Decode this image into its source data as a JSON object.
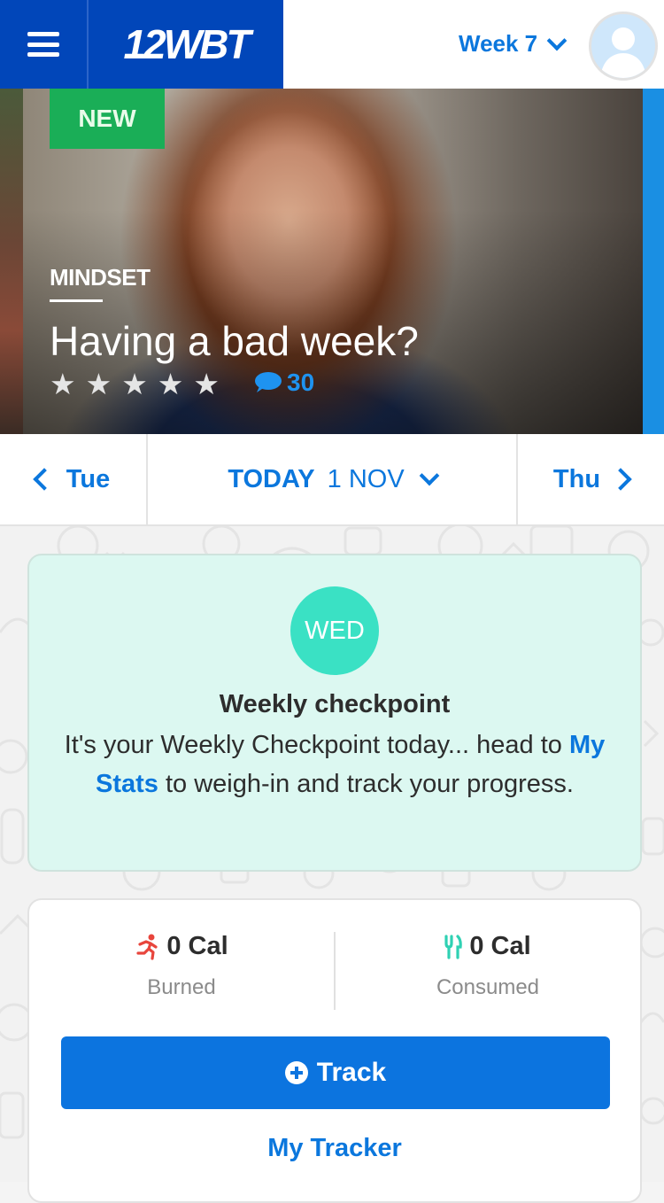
{
  "header": {
    "logo": "12WBT",
    "week_label": "Week 7"
  },
  "hero": {
    "badge": "NEW",
    "category": "MINDSET",
    "title": "Having a bad week?",
    "rating": 5,
    "comment_count": "30"
  },
  "day_nav": {
    "prev_label": "Tue",
    "today_label": "TODAY",
    "today_date": "1 NOV",
    "next_label": "Thu"
  },
  "checkpoint": {
    "day_badge": "WED",
    "title": "Weekly checkpoint",
    "body_before": "It's your Weekly Checkpoint today... head to ",
    "link_text": "My Stats",
    "body_after": " to weigh-in and track your progress."
  },
  "tracker": {
    "burned_value": "0 Cal",
    "burned_label": "Burned",
    "consumed_value": "0 Cal",
    "consumed_label": "Consumed",
    "track_button": "Track",
    "my_tracker_link": "My Tracker"
  },
  "colors": {
    "brand_blue": "#0146b9",
    "accent_blue": "#0b77dd",
    "new_green": "#1aae57",
    "wed_teal": "#3ae1c4",
    "card_mint": "#dcf8f1",
    "burn_red": "#e8453c",
    "consume_teal": "#2fd1b3"
  },
  "icons": {
    "menu": "hamburger-icon",
    "week_dropdown": "chevron-down-icon",
    "avatar": "user-avatar-icon",
    "star": "star-icon",
    "comments": "speech-bubble-icon",
    "prev": "chevron-left-icon",
    "next": "chevron-right-icon",
    "burned": "running-person-icon",
    "consumed": "fork-knife-icon",
    "track": "plus-circle-icon"
  }
}
